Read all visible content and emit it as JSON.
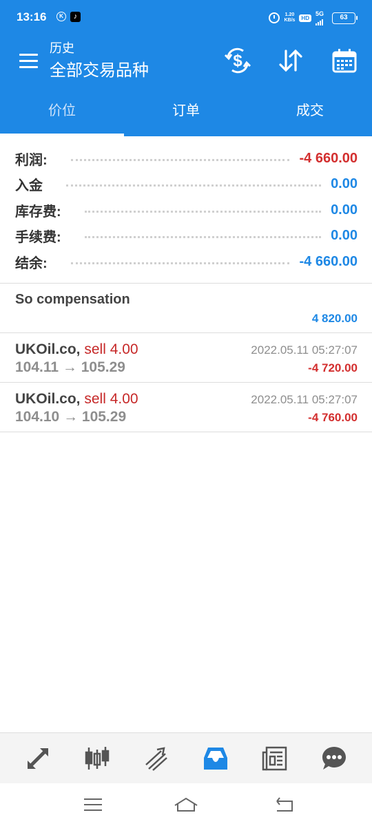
{
  "status_bar": {
    "time": "13:16",
    "speed_value": "1.20",
    "speed_unit": "KB/s",
    "hd": "HD",
    "network": "5G",
    "battery": "63"
  },
  "toolbar": {
    "subtitle": "历史",
    "title": "全部交易品种"
  },
  "tabs": [
    {
      "label": "价位",
      "active": true
    },
    {
      "label": "订单",
      "active": false
    },
    {
      "label": "成交",
      "active": false
    }
  ],
  "summary": [
    {
      "label": "利润:",
      "value": "-4 660.00",
      "color": "#d32f2f"
    },
    {
      "label": "入金",
      "value": "0.00",
      "color": "#1e88e5"
    },
    {
      "label": "库存费:",
      "value": "0.00",
      "color": "#1e88e5"
    },
    {
      "label": "手续费:",
      "value": "0.00",
      "color": "#1e88e5"
    },
    {
      "label": "结余:",
      "value": "-4 660.00",
      "color": "#1e88e5"
    }
  ],
  "compensation": {
    "title": "So compensation",
    "amount": "4 820.00",
    "color": "#1e88e5"
  },
  "deals": [
    {
      "symbol": "UKOil.co,",
      "side": "sell 4.00",
      "prices": "104.11 → 105.29",
      "time": "2022.05.11 05:27:07",
      "profit": "-4 720.00",
      "profit_color": "#d32f2f"
    },
    {
      "symbol": "UKOil.co,",
      "side": "sell 4.00",
      "prices": "104.10 → 105.29",
      "time": "2022.05.11 05:27:07",
      "profit": "-4 760.00",
      "profit_color": "#d32f2f"
    }
  ],
  "bottom_nav": [
    {
      "icon": "quotes-icon",
      "active": false
    },
    {
      "icon": "chart-candles-icon",
      "active": false
    },
    {
      "icon": "trade-icon",
      "active": false
    },
    {
      "icon": "history-icon",
      "active": true
    },
    {
      "icon": "news-icon",
      "active": false
    },
    {
      "icon": "chat-icon",
      "active": false
    }
  ],
  "colors": {
    "primary": "#1e88e5",
    "loss": "#d32f2f",
    "nav_icon": "#555555"
  }
}
